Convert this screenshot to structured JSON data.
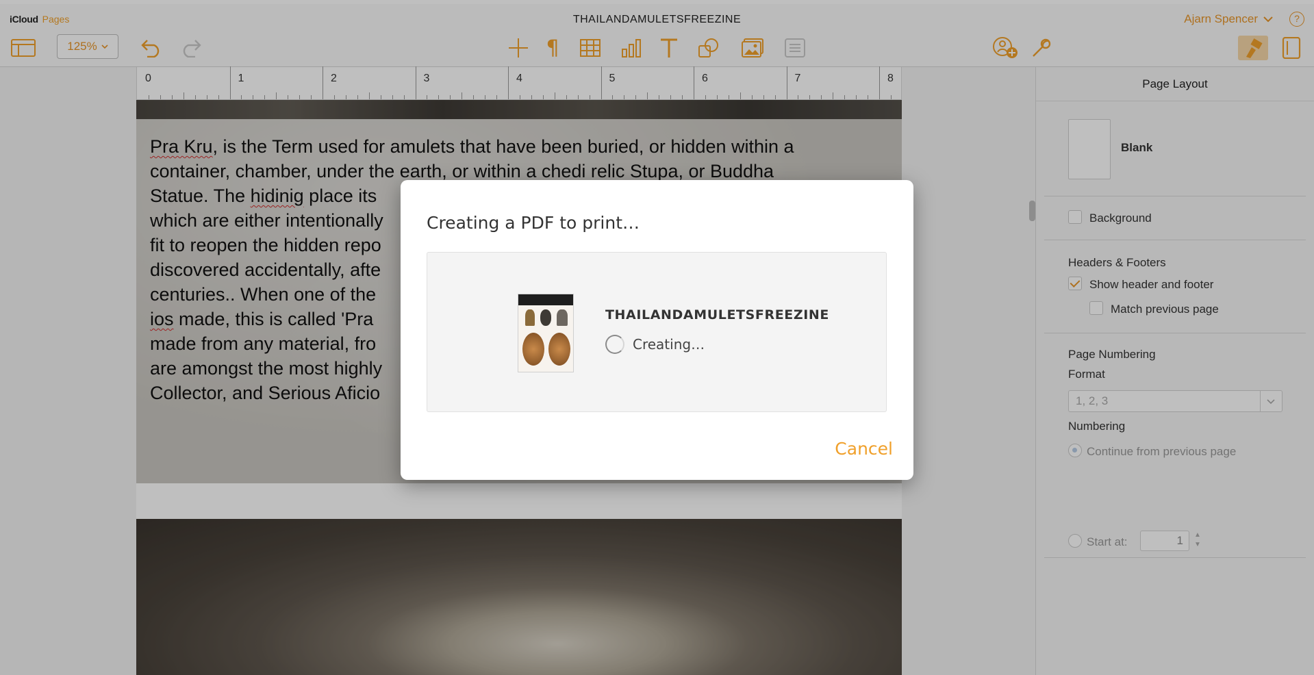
{
  "app": {
    "brand": "iCloud",
    "app_name": "Pages",
    "document_title": "THAILANDAMULETSFREEZINE"
  },
  "user": {
    "name": "Ajarn Spencer",
    "help_label": "?"
  },
  "toolbar": {
    "zoom": "125%",
    "left_icons": [
      "sidebar-icon",
      "undo-icon",
      "redo-icon"
    ],
    "center_icons": [
      "insert-icon",
      "paragraph-icon",
      "table-icon",
      "chart-icon",
      "text-icon",
      "shape-icon",
      "media-icon",
      "comment-icon"
    ],
    "right_icons": [
      "collaborate-icon",
      "tools-icon",
      "format-icon",
      "document-icon"
    ],
    "accent_color": "#f0a02b"
  },
  "ruler": {
    "numbers": [
      "0",
      "1",
      "2",
      "3",
      "4",
      "5",
      "6",
      "7",
      "8"
    ]
  },
  "document": {
    "body_lines": [
      [
        "Pra Kru",
        ", is the Term used for amulets that have been buried, or hidden within a"
      ],
      [
        "container, chamber, under the earth, or within a ",
        "chedi",
        " relic Stupa, or Buddha"
      ],
      [
        "Statue. The ",
        "hidinig",
        " place its"
      ],
      [
        "which are either intentionally"
      ],
      [
        "fit to reopen the hidden repo"
      ],
      [
        "discovered accidentally, afte"
      ],
      [
        "centuries.. When one of the"
      ],
      [
        "ios",
        " made, this is called 'Pra"
      ],
      [
        "made from any material, fro"
      ],
      [
        "are amongst the most highly"
      ],
      [
        "Collector, and Serious Aficio"
      ]
    ]
  },
  "sidebar": {
    "title": "Page Layout",
    "template_label": "Blank",
    "background_label": "Background",
    "headers_footers_title": "Headers & Footers",
    "show_header_footer": "Show header and footer",
    "match_previous": "Match previous page",
    "page_numbering_title": "Page Numbering",
    "format_label": "Format",
    "format_value": "1, 2, 3",
    "numbering_label": "Numbering",
    "continue_label": "Continue from previous page",
    "start_at_label": "Start at:",
    "start_at_value": "1"
  },
  "dialog": {
    "title": "Creating a PDF to print…",
    "document_name": "THAILANDAMULETSFREEZINE",
    "status": "Creating…",
    "cancel_label": "Cancel"
  }
}
